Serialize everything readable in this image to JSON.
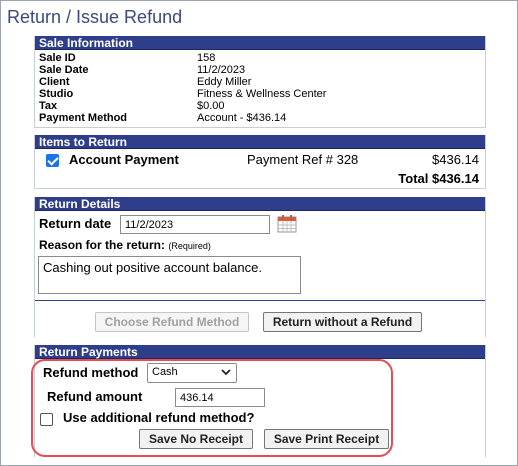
{
  "page_title": "Return / Issue Refund",
  "sale_info": {
    "header": "Sale Information",
    "rows": [
      {
        "label": "Sale ID",
        "value": "158"
      },
      {
        "label": "Sale Date",
        "value": "11/2/2023"
      },
      {
        "label": "Client",
        "value": "Eddy Miller"
      },
      {
        "label": "Studio",
        "value": "Fitness & Wellness Center"
      },
      {
        "label": "Tax",
        "value": "$0.00"
      },
      {
        "label": "Payment Method",
        "value": "Account - $436.14"
      }
    ]
  },
  "items": {
    "header": "Items to Return",
    "row": {
      "name": "Account Payment",
      "ref": "Payment Ref # 328",
      "amount": "$436.14",
      "checked": true
    },
    "total": "Total $436.14"
  },
  "return_details": {
    "header": "Return Details",
    "date_label": "Return date",
    "date_value": "11/2/2023",
    "reason_label": "Reason for the return:",
    "reason_required": "(Required)",
    "reason_value": "Cashing out positive account balance.",
    "choose_method_button": "Choose Refund Method",
    "return_without_refund_button": "Return without a Refund"
  },
  "return_payments": {
    "header": "Return Payments",
    "method_label": "Refund method",
    "method_value": "Cash",
    "amount_label": "Refund amount",
    "amount_value": "436.14",
    "additional_label": "Use additional refund method?",
    "save_no_receipt": "Save No Receipt",
    "save_print_receipt": "Save Print Receipt"
  },
  "colors": {
    "header_bg": "#2e3e8a",
    "checkbox": "#1a73e8",
    "highlight": "#e84b52"
  }
}
